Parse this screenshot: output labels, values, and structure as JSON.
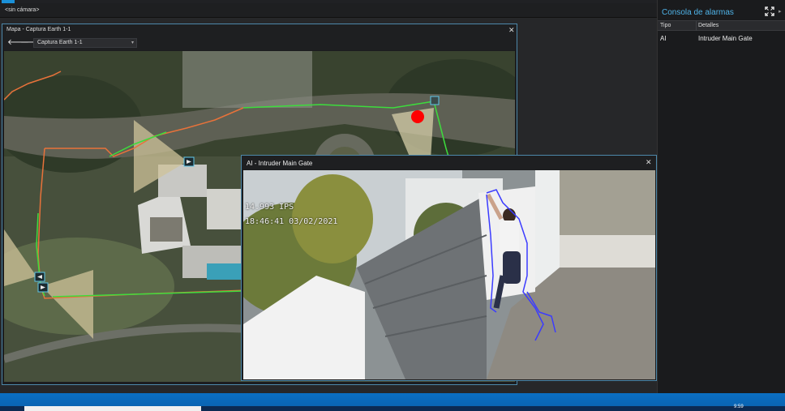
{
  "camera_bar": {
    "label": "<sin cámara>"
  },
  "map_window": {
    "title": "Mapa - Captura Earth 1-1",
    "selected_map": "Captura Earth 1-1"
  },
  "video_window": {
    "title": "AI - Intruder Main Gate",
    "fps": "14.993 IPS",
    "timestamp": "18:46:41 03/02/2021"
  },
  "alarm_console": {
    "title": "Consola de alarmas",
    "columns": {
      "type": "Tipo",
      "details": "Detalles"
    },
    "rows": [
      {
        "type": "AI",
        "details": "Intruder Main Gate"
      }
    ]
  },
  "taskbar": {
    "clock": "9:59"
  },
  "colors": {
    "accent": "#4fb3e8",
    "window_border": "#4d88aa",
    "alarm_marker": "#ff0000",
    "route_green": "#3ddc3d",
    "route_orange": "#e8723a",
    "tracking_outline": "#3b3bff"
  },
  "icons": {
    "back": "arrow-left-icon",
    "forward": "arrow-right-icon",
    "close": "close-icon",
    "expand": "fullscreen-icon",
    "camera": "camera-icon"
  }
}
